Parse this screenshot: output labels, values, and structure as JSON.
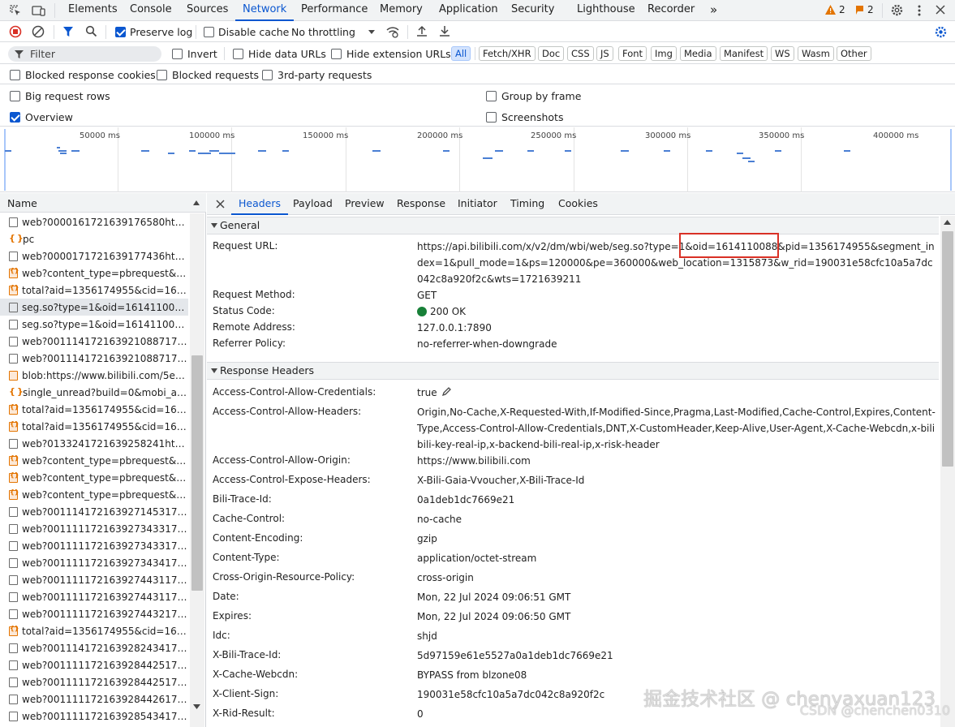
{
  "top_tabs": [
    "Elements",
    "Console",
    "Sources",
    "Network",
    "Performance",
    "Memory",
    "Application",
    "Security",
    "Lighthouse",
    "Recorder"
  ],
  "more_tabs": "»",
  "warnings": "2",
  "issues": "2",
  "toolbar": {
    "preserve_log": "Preserve log",
    "disable_cache": "Disable cache",
    "throttling": "No throttling"
  },
  "filter": {
    "placeholder": "Filter",
    "invert": "Invert",
    "hide_data_urls": "Hide data URLs",
    "hide_extension_urls": "Hide extension URLs",
    "types": [
      "All",
      "Fetch/XHR",
      "Doc",
      "CSS",
      "JS",
      "Font",
      "Img",
      "Media",
      "Manifest",
      "WS",
      "Wasm",
      "Other"
    ]
  },
  "options": {
    "blocked_response_cookies": "Blocked response cookies",
    "blocked_requests": "Blocked requests",
    "third_party": "3rd-party requests",
    "big_request_rows": "Big request rows",
    "group_by_frame": "Group by frame",
    "overview": "Overview",
    "screenshots": "Screenshots"
  },
  "timeline": {
    "ticks": [
      "50000 ms",
      "100000 ms",
      "150000 ms",
      "200000 ms",
      "250000 ms",
      "300000 ms",
      "350000 ms",
      "400000 ms"
    ]
  },
  "requests": {
    "header": "Name",
    "items": [
      {
        "name": "web?0000161721639176580https...",
        "kind": "doc"
      },
      {
        "name": "pc",
        "kind": "js"
      },
      {
        "name": "web?0000171721639177436https...",
        "kind": "doc"
      },
      {
        "name": "web?content_type=pbrequest&lo...",
        "kind": "xhr"
      },
      {
        "name": "total?aid=1356174955&cid=1614...",
        "kind": "xhr"
      },
      {
        "name": "seg.so?type=1&oid=1614110088...",
        "kind": "doc",
        "selected": true
      },
      {
        "name": "seg.so?type=1&oid=1614110088...",
        "kind": "doc"
      },
      {
        "name": "web?00111417216392108871721...",
        "kind": "doc"
      },
      {
        "name": "web?00111417216392108871721...",
        "kind": "doc"
      },
      {
        "name": "blob:https://www.bilibili.com/5e1...",
        "kind": "blob"
      },
      {
        "name": "single_unread?build=0&mobi_app...",
        "kind": "js"
      },
      {
        "name": "total?aid=1356174955&cid=1614...",
        "kind": "xhr"
      },
      {
        "name": "total?aid=1356174955&cid=1614...",
        "kind": "xhr"
      },
      {
        "name": "web?0133241721639258241https...",
        "kind": "doc"
      },
      {
        "name": "web?content_type=pbrequest&lo...",
        "kind": "xhr"
      },
      {
        "name": "web?content_type=pbrequest&lo...",
        "kind": "xhr"
      },
      {
        "name": "web?content_type=pbrequest&lo...",
        "kind": "xhr"
      },
      {
        "name": "web?00111417216392714531721...",
        "kind": "doc"
      },
      {
        "name": "web?00111117216392734331721...",
        "kind": "doc"
      },
      {
        "name": "web?00111117216392734331721...",
        "kind": "doc"
      },
      {
        "name": "web?00111117216392734341721...",
        "kind": "doc"
      },
      {
        "name": "web?00111117216392744311721...",
        "kind": "doc"
      },
      {
        "name": "web?00111117216392744311721...",
        "kind": "doc"
      },
      {
        "name": "web?00111117216392744321721...",
        "kind": "doc"
      },
      {
        "name": "total?aid=1356174955&cid=1614...",
        "kind": "xhr"
      },
      {
        "name": "web?00111417216392824341721...",
        "kind": "doc"
      },
      {
        "name": "web?00111117216392844251721...",
        "kind": "doc"
      },
      {
        "name": "web?00111117216392844251721...",
        "kind": "doc"
      },
      {
        "name": "web?00111117216392844261721...",
        "kind": "doc"
      },
      {
        "name": "web?00111117216392854341721...",
        "kind": "doc"
      }
    ]
  },
  "detail_tabs": [
    "Headers",
    "Payload",
    "Preview",
    "Response",
    "Initiator",
    "Timing",
    "Cookies"
  ],
  "general": {
    "title": "General",
    "rows": [
      {
        "k": "Request URL:",
        "v": "https://api.bilibili.com/x/v2/dm/wbi/web/seg.so?type=1&oid=1614110088&pid=1356174955&segment_index=1&pull_mode=1&ps=120000&pe=360000&web_location=1315873&w_rid=190031e58cfc10a5a7dc042c8a920f2c&wts=1721639211"
      },
      {
        "k": "Request Method:",
        "v": "GET"
      },
      {
        "k": "Status Code:",
        "v": "200 OK"
      },
      {
        "k": "Remote Address:",
        "v": "127.0.0.1:7890"
      },
      {
        "k": "Referrer Policy:",
        "v": "no-referrer-when-downgrade"
      }
    ]
  },
  "response_headers": {
    "title": "Response Headers",
    "rows": [
      {
        "k": "Access-Control-Allow-Credentials:",
        "v": "true"
      },
      {
        "k": "Access-Control-Allow-Headers:",
        "v": "Origin,No-Cache,X-Requested-With,If-Modified-Since,Pragma,Last-Modified,Cache-Control,Expires,Content-Type,Access-Control-Allow-Credentials,DNT,X-CustomHeader,Keep-Alive,User-Agent,X-Cache-Webcdn,x-bilibili-key-real-ip,x-backend-bili-real-ip,x-risk-header"
      },
      {
        "k": "Access-Control-Allow-Origin:",
        "v": "https://www.bilibili.com"
      },
      {
        "k": "Access-Control-Expose-Headers:",
        "v": "X-Bili-Gaia-Vvoucher,X-Bili-Trace-Id"
      },
      {
        "k": "Bili-Trace-Id:",
        "v": "0a1deb1dc7669e21"
      },
      {
        "k": "Cache-Control:",
        "v": "no-cache"
      },
      {
        "k": "Content-Encoding:",
        "v": "gzip"
      },
      {
        "k": "Content-Type:",
        "v": "application/octet-stream"
      },
      {
        "k": "Cross-Origin-Resource-Policy:",
        "v": "cross-origin"
      },
      {
        "k": "Date:",
        "v": "Mon, 22 Jul 2024 09:06:51 GMT"
      },
      {
        "k": "Expires:",
        "v": "Mon, 22 Jul 2024 09:06:50 GMT"
      },
      {
        "k": "Idc:",
        "v": "shjd"
      },
      {
        "k": "X-Bili-Trace-Id:",
        "v": "5d97159e61e5527a0a1deb1dc7669e21"
      },
      {
        "k": "X-Cache-Webcdn:",
        "v": "BYPASS from blzone08"
      },
      {
        "k": "X-Client-Sign:",
        "v": "190031e58cfc10a5a7dc042c8a920f2c"
      },
      {
        "k": "X-Rid-Result:",
        "v": "0"
      }
    ]
  },
  "watermark": {
    "line1": "掘金技术社区 @ chenyaxuan123",
    "line2": "CSDN @chenchen0310"
  },
  "colors": {
    "accent": "#0b57d0",
    "status_ok": "#188038",
    "highlight_box": "#d93025"
  }
}
